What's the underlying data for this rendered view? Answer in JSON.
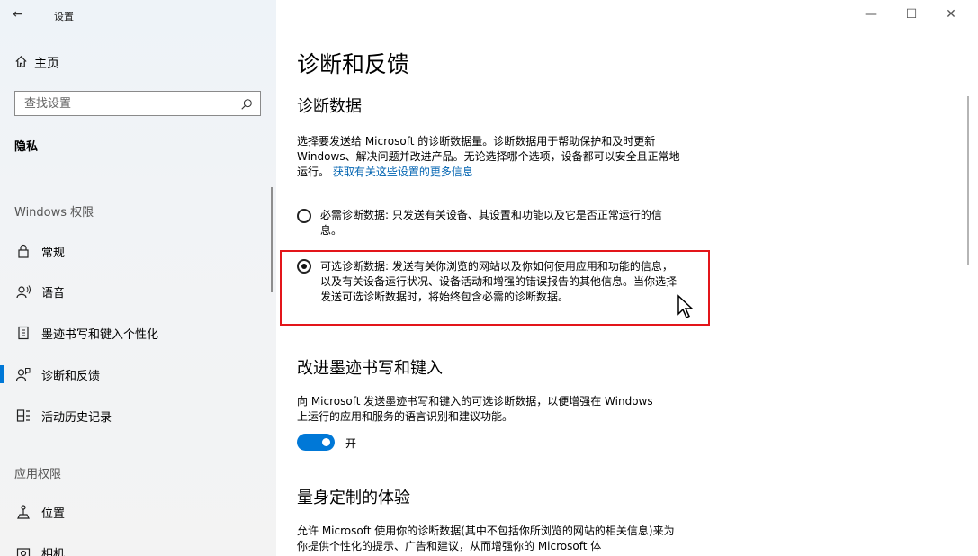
{
  "window": {
    "title": "设置",
    "back_glyph": "←",
    "controls": {
      "minimize": "—",
      "maximize": "☐",
      "close": "✕"
    }
  },
  "sidebar": {
    "home": "主页",
    "search_placeholder": "查找设置",
    "category": "隐私",
    "sections": [
      "Windows 权限",
      "应用权限"
    ],
    "items": [
      {
        "label": "常规",
        "icon": "lock-icon"
      },
      {
        "label": "语音",
        "icon": "speech-icon"
      },
      {
        "label": "墨迹书写和键入个性化",
        "icon": "notebook-icon"
      },
      {
        "label": "诊断和反馈",
        "icon": "feedback-icon",
        "active": true
      },
      {
        "label": "活动历史记录",
        "icon": "activity-icon"
      },
      {
        "label": "位置",
        "icon": "location-icon"
      },
      {
        "label": "相机",
        "icon": "camera-icon"
      }
    ]
  },
  "page": {
    "title": "诊断和反馈",
    "diag_heading": "诊断数据",
    "diag_desc": "选择要发送给 Microsoft 的诊断数据量。诊断数据用于帮助保护和及时更新 Windows、解决问题并改进产品。无论选择哪个选项，设备都可以安全且正常地运行。",
    "diag_link": "获取有关这些设置的更多信息",
    "options": [
      {
        "label": "必需诊断数据: 只发送有关设备、其设置和功能以及它是否正常运行的信息。",
        "selected": false
      },
      {
        "label": "可选诊断数据: 发送有关你浏览的网站以及你如何使用应用和功能的信息，以及有关设备运行状况、设备活动和增强的错误报告的其他信息。当你选择发送可选诊断数据时，将始终包含必需的诊断数据。",
        "selected": true
      }
    ],
    "ink_heading": "改进墨迹书写和键入",
    "ink_desc": "向 Microsoft 发送墨迹书写和键入的可选诊断数据，以便增强在 Windows 上运行的应用和服务的语言识别和建议功能。",
    "toggle_label": "开",
    "toggle_on": true,
    "tailored_heading": "量身定制的体验",
    "tailored_desc": "允许 Microsoft 使用你的诊断数据(其中不包括你所浏览的网站的相关信息)来为你提供个性化的提示、广告和建议，从而增强你的 Microsoft 体"
  },
  "colors": {
    "accent": "#0078d7",
    "highlight_border": "#e3151a",
    "link": "#0063b1"
  }
}
